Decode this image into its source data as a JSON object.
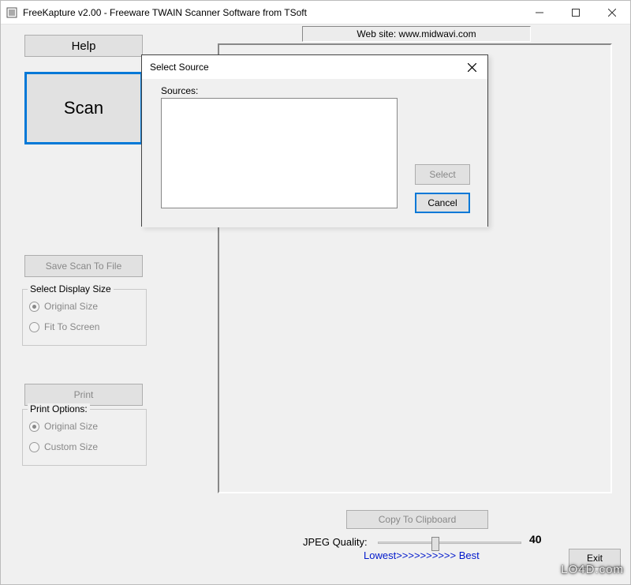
{
  "window": {
    "title": "FreeKapture v2.00 - Freeware TWAIN Scanner Software from TSoft"
  },
  "header": {
    "help": "Help",
    "website": "Web site: www.midwavi.com"
  },
  "buttons": {
    "scan": "Scan",
    "save": "Save Scan To File",
    "print": "Print",
    "copy": "Copy To Clipboard",
    "exit": "Exit"
  },
  "displaySize": {
    "legend": "Select Display Size",
    "options": [
      "Original Size",
      "Fit To Screen"
    ],
    "selected": 0
  },
  "printOptions": {
    "legend": "Print Options:",
    "options": [
      "Original Size",
      "Custom Size"
    ],
    "selected": 0
  },
  "jpeg": {
    "label": "JPEG Quality:",
    "value": "40",
    "scale": "Lowest>>>>>>>>>> Best"
  },
  "dialog": {
    "title": "Select Source",
    "sources_label": "Sources:",
    "select": "Select",
    "cancel": "Cancel"
  },
  "watermark": "LO4D.com"
}
